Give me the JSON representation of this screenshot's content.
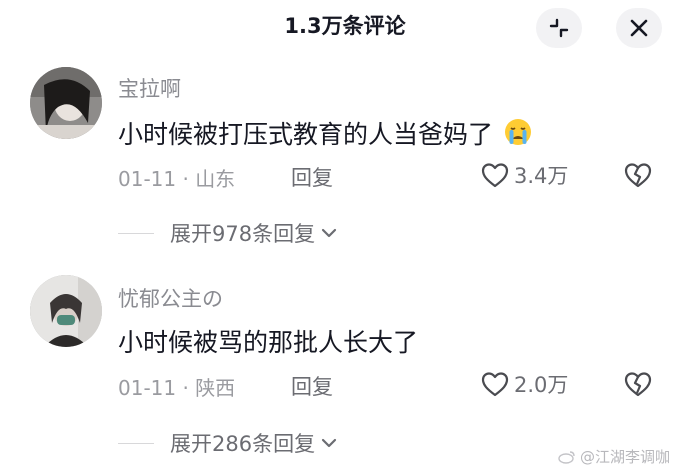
{
  "header": {
    "title": "1.3万条评论"
  },
  "comments": [
    {
      "username": "宝拉啊",
      "text": "小时候被打压式教育的人当爸妈了",
      "date_location": "01-11 · 山东",
      "reply_label": "回复",
      "likes": "3.4万",
      "expand_label": "展开978条回复"
    },
    {
      "username": "忧郁公主の",
      "text": "小时候被骂的那批人长大了",
      "date_location": "01-11 · 陕西",
      "reply_label": "回复",
      "likes": "2.0万",
      "expand_label": "展开286条回复"
    }
  ],
  "watermark": "@江湖李调咖",
  "icons": {
    "expand": "collapse-corners-icon",
    "close": "close-icon",
    "like": "heart-outline-icon",
    "dislike": "broken-heart-icon",
    "emoji": "crying-face-emoji",
    "chevron": "chevron-down-icon"
  }
}
